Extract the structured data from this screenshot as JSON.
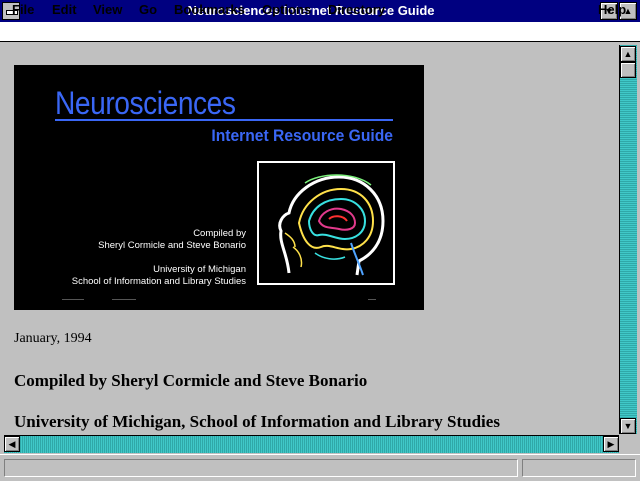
{
  "window": {
    "title": "Neurosciences Internet Resource Guide",
    "minimize_icon": "triangle-down-icon",
    "maximize_icon": "triangle-up-icon"
  },
  "menu": {
    "items": [
      "File",
      "Edit",
      "View",
      "Go",
      "Bookmarks",
      "Options",
      "Directory"
    ],
    "help": "Help"
  },
  "banner": {
    "title": "Neurosciences",
    "subtitle": "Internet Resource Guide",
    "compiled_line1": "Compiled by",
    "compiled_line2": "Sheryl Cormicle and Steve Bonario",
    "affil_line1": "University of Michigan",
    "affil_line2": "School of Information and Library Studies",
    "accent_color": "#3a67f5"
  },
  "page": {
    "date": "January, 1994",
    "compiled": "Compiled by Sheryl Cormicle and Steve Bonario",
    "university": "University of Michigan, School of Information and Library Studies"
  },
  "icons": {
    "scroll_up": "arrow-up-icon",
    "scroll_down": "arrow-down-icon",
    "scroll_left": "arrow-left-icon",
    "scroll_right": "arrow-right-icon"
  },
  "colors": {
    "titlebar": "#000080",
    "scroll_track": "#40c0c0"
  }
}
